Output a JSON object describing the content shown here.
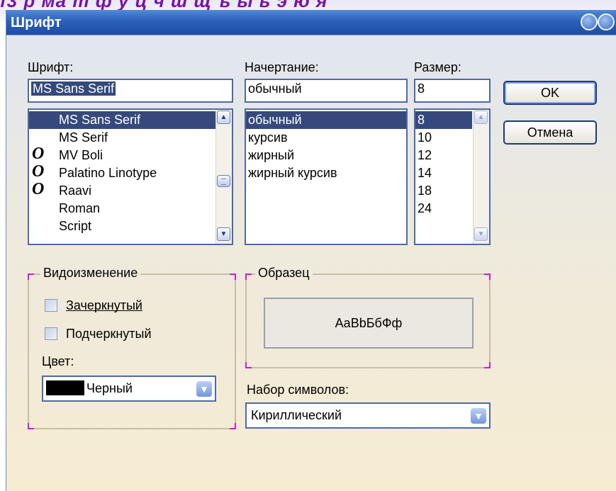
{
  "window": {
    "title": "Шрифт"
  },
  "font": {
    "label": "Шрифт:",
    "value": "MS Sans Serif",
    "items": [
      {
        "label": "MS Sans Serif",
        "opentype": false,
        "selected": true
      },
      {
        "label": "MS Serif",
        "opentype": false,
        "selected": false
      },
      {
        "label": "MV Boli",
        "opentype": true,
        "selected": false
      },
      {
        "label": "Palatino Linotype",
        "opentype": true,
        "selected": false
      },
      {
        "label": "Raavi",
        "opentype": true,
        "selected": false
      },
      {
        "label": "Roman",
        "opentype": false,
        "selected": false
      },
      {
        "label": "Script",
        "opentype": false,
        "selected": false
      }
    ]
  },
  "style": {
    "label": "Начертание:",
    "value": "обычный",
    "items": [
      "обычный",
      "курсив",
      "жирный",
      "жирный курсив"
    ],
    "selected_index": 0
  },
  "size": {
    "label": "Размер:",
    "value": "8",
    "items": [
      "8",
      "10",
      "12",
      "14",
      "18",
      "24"
    ],
    "selected_index": 0
  },
  "buttons": {
    "ok": "OK",
    "cancel": "Отмена"
  },
  "effects": {
    "title": "Видоизменение",
    "strikeout": "Зачеркнутый",
    "underline": "Подчеркнутый",
    "color_label": "Цвет:",
    "color_value": "Черный",
    "color_swatch": "#000000"
  },
  "sample": {
    "title": "Образец",
    "text": "AaBbБбФф"
  },
  "charset": {
    "label": "Набор символов:",
    "value": "Кириллический"
  },
  "colors": {
    "titlebar": "#2a5fb8",
    "selection": "#35497c",
    "group_corner": "#d61ad6"
  }
}
